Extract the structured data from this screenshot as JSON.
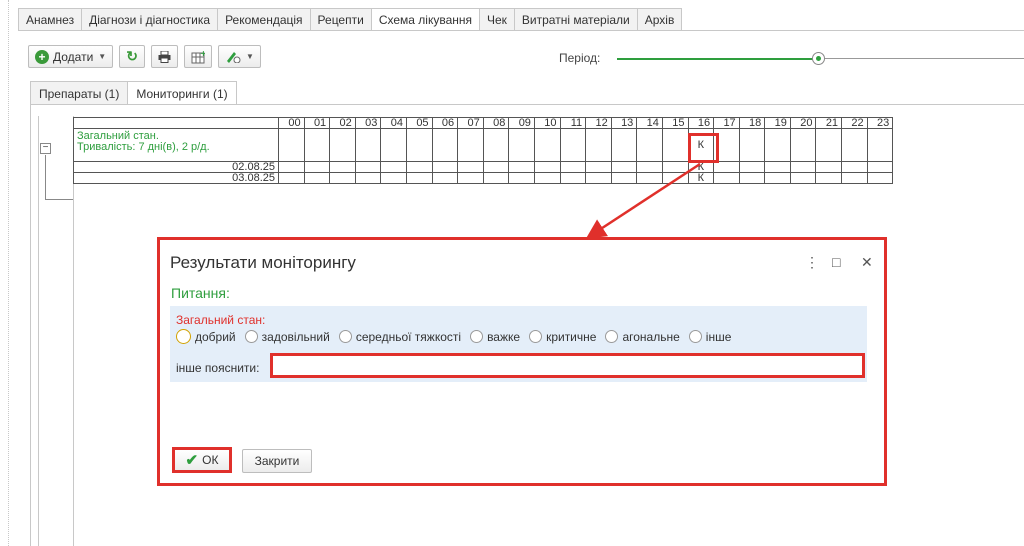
{
  "main_tabs": [
    "Анамнез",
    "Діагнози і діагностика",
    "Рекомендація",
    "Рецепти",
    "Схема лікування",
    "Чек",
    "Витратні матеріали",
    "Архів"
  ],
  "toolbar": {
    "add_label": "Додати",
    "period_label": "Період:"
  },
  "sub_tabs": [
    "Препараты (1)",
    "Мониторинги (1)"
  ],
  "grid": {
    "hours": [
      "00",
      "01",
      "02",
      "03",
      "04",
      "05",
      "06",
      "07",
      "08",
      "09",
      "10",
      "11",
      "12",
      "13",
      "14",
      "15",
      "16",
      "17",
      "18",
      "19",
      "20",
      "21",
      "22",
      "23"
    ],
    "item_name": "Загальний стан.",
    "item_duration": "Тривалість: 7 дні(в), 2 р/д.",
    "rows": [
      {
        "date": "",
        "mark_hour": 16,
        "mark": "К"
      },
      {
        "date": "02.08.25",
        "mark_hour": 16,
        "mark": "К"
      },
      {
        "date": "03.08.25",
        "mark_hour": 16,
        "mark": "К"
      }
    ]
  },
  "dialog": {
    "title": "Результати моніторингу",
    "section": "Питання:",
    "question": "Загальний стан:",
    "options": [
      "добрий",
      "задовільний",
      "середньої тяжкості",
      "важке",
      "критичне",
      "агональне",
      "інше"
    ],
    "other_label": "інше пояснити:",
    "other_value": "",
    "ok_label": "ОК",
    "close_label": "Закрити",
    "menu_icon": "⋮",
    "max_icon": "□",
    "close_icon": "✕"
  },
  "colors": {
    "accent_green": "#2e9e3e",
    "highlight_red": "#e0302b",
    "band_blue": "#e4eef9"
  }
}
